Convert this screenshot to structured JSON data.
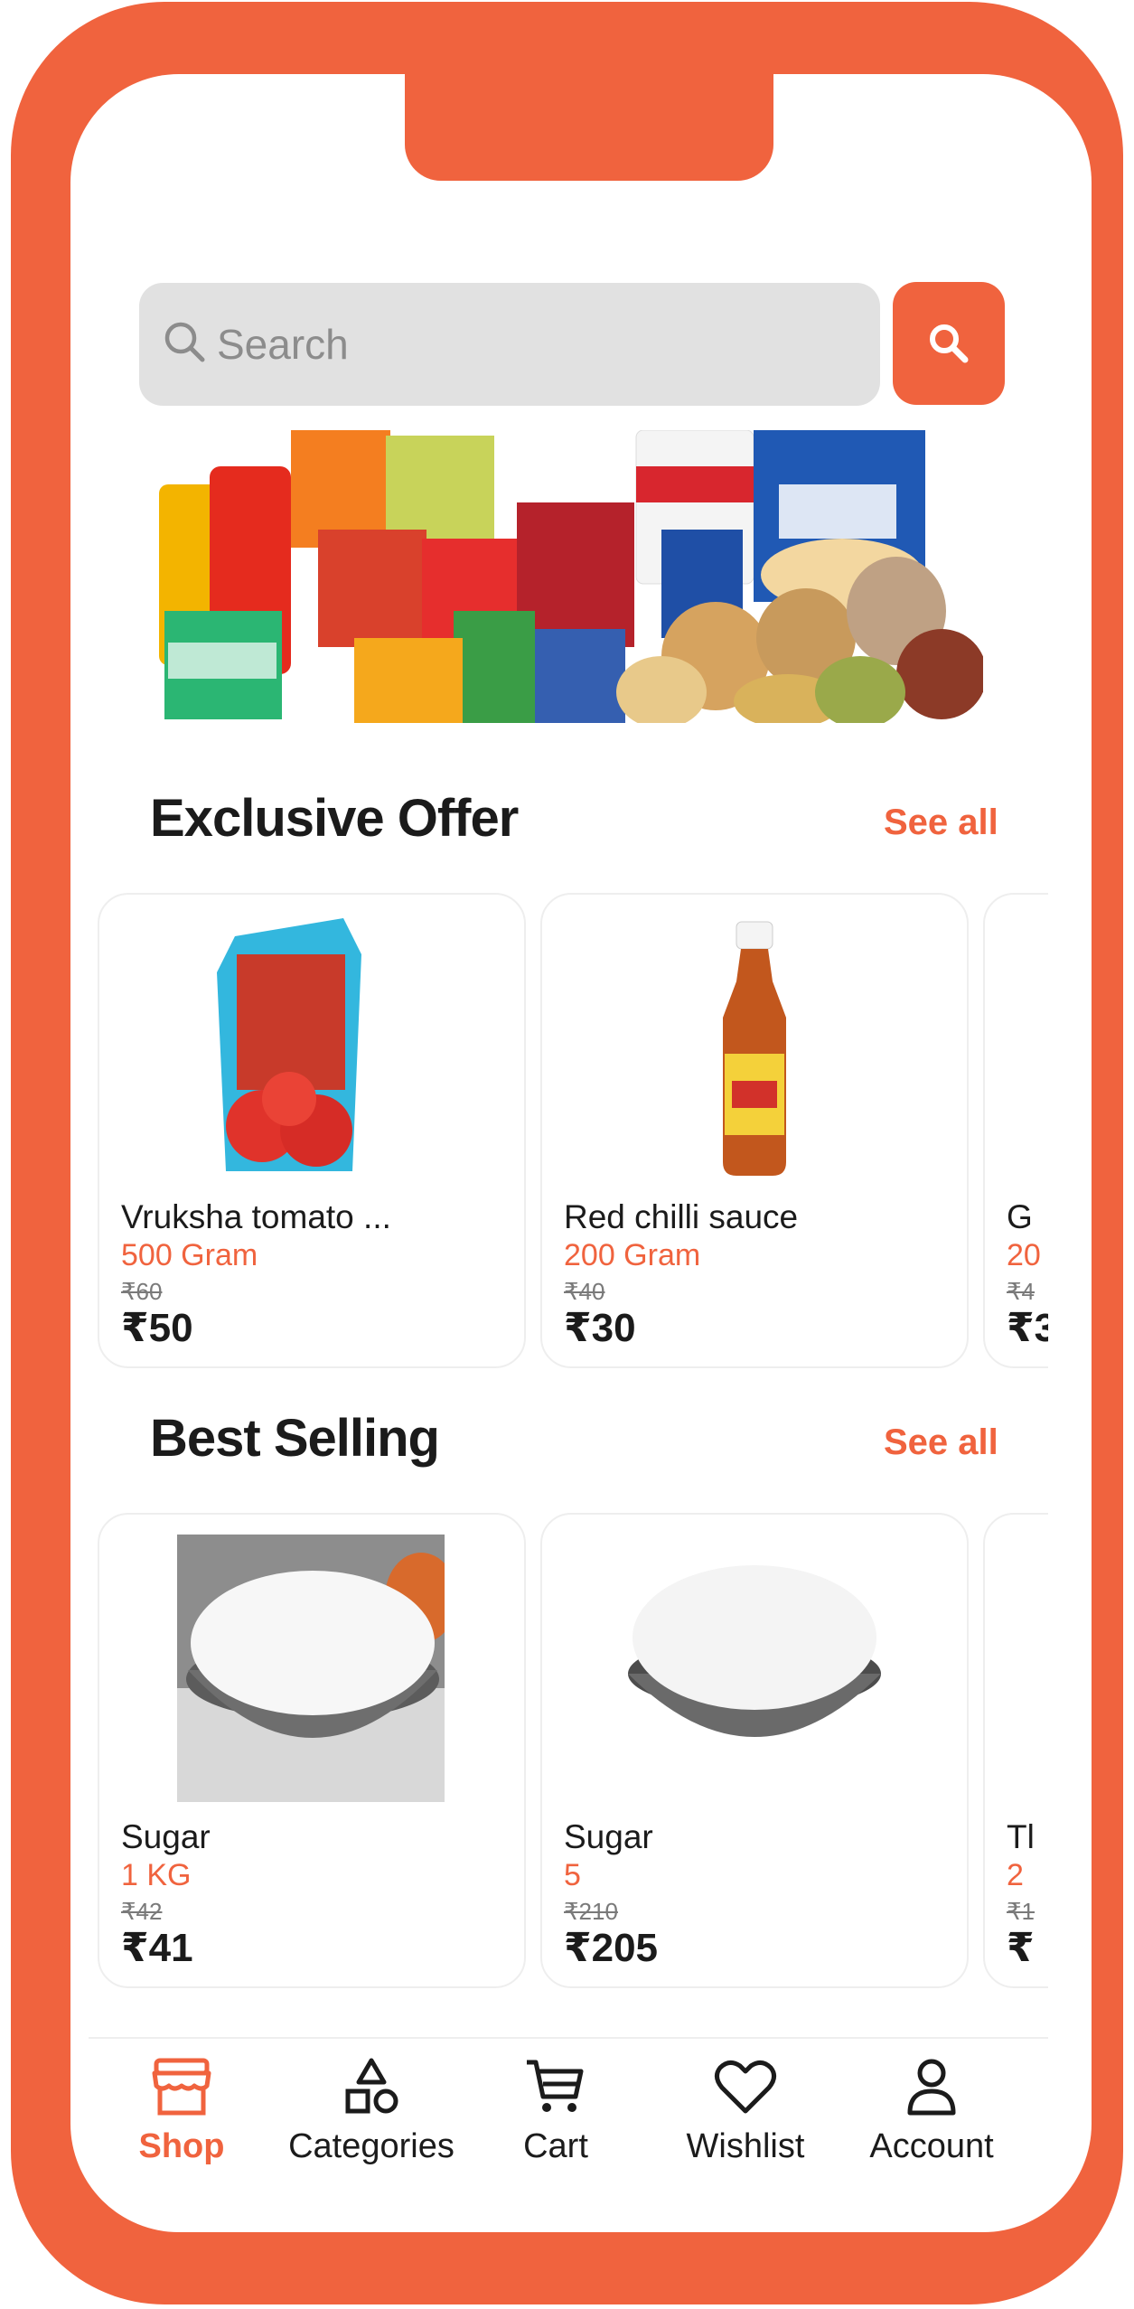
{
  "search": {
    "placeholder": "Search"
  },
  "colors": {
    "accent": "#F0633E",
    "text": "#1b1b1b",
    "muted": "#7a7a7a",
    "field_bg": "#e1e1e1"
  },
  "banner": {
    "label": "grocery-products-banner"
  },
  "exclusive_offer": {
    "title": "Exclusive Offer",
    "see_all": "See all",
    "products": [
      {
        "name": "Vruksha tomato ...",
        "qty": "500 Gram",
        "old_price": "₹60",
        "price": "₹50",
        "image": "tomato-ketchup-pouch"
      },
      {
        "name": "Red chilli sauce",
        "qty": "200 Gram",
        "old_price": "₹40",
        "price": "₹30",
        "image": "chilli-sauce-bottle"
      },
      {
        "name": "G",
        "qty": "20",
        "old_price": "₹4",
        "price": "₹3",
        "image": "partial-product"
      }
    ]
  },
  "best_selling": {
    "title": "Best Selling",
    "see_all": "See all",
    "products": [
      {
        "name": "Sugar",
        "qty": "1 KG",
        "old_price": "₹42",
        "price": "₹41",
        "image": "sugar-bowl"
      },
      {
        "name": "Sugar",
        "qty": "5",
        "old_price": "₹210",
        "price": "₹205",
        "image": "sugar-bowl-white"
      },
      {
        "name": "Tl",
        "qty": "2",
        "old_price": "₹1",
        "price": "₹",
        "image": "partial-product"
      }
    ]
  },
  "nav": {
    "items": [
      {
        "label": "Shop",
        "icon": "store-icon",
        "active": true
      },
      {
        "label": "Categories",
        "icon": "shapes-icon"
      },
      {
        "label": "Cart",
        "icon": "cart-icon"
      },
      {
        "label": "Wishlist",
        "icon": "heart-icon"
      },
      {
        "label": "Account",
        "icon": "user-icon"
      }
    ]
  }
}
